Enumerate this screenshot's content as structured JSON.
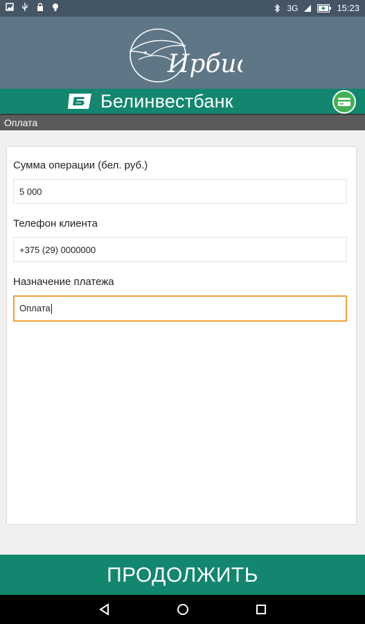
{
  "status_bar": {
    "network": "3G",
    "time": "15:23"
  },
  "header": {
    "logo_text": "Ирбис"
  },
  "bank_bar": {
    "bank_name": "Белинвестбанк"
  },
  "title_bar": {
    "title": "Оплата"
  },
  "form": {
    "amount_label": "Сумма операции (бел. руб.)",
    "amount_value": "5 000",
    "phone_label": "Телефон клиента",
    "phone_value": "+375 (29) 0000000",
    "purpose_label": "Назначение платежа",
    "purpose_value": "Оплата"
  },
  "footer": {
    "continue_label": "ПРОДОЛЖИТЬ"
  },
  "colors": {
    "header": "#5f7687",
    "bank_green": "#12866e",
    "active_border": "#f0a23d"
  }
}
